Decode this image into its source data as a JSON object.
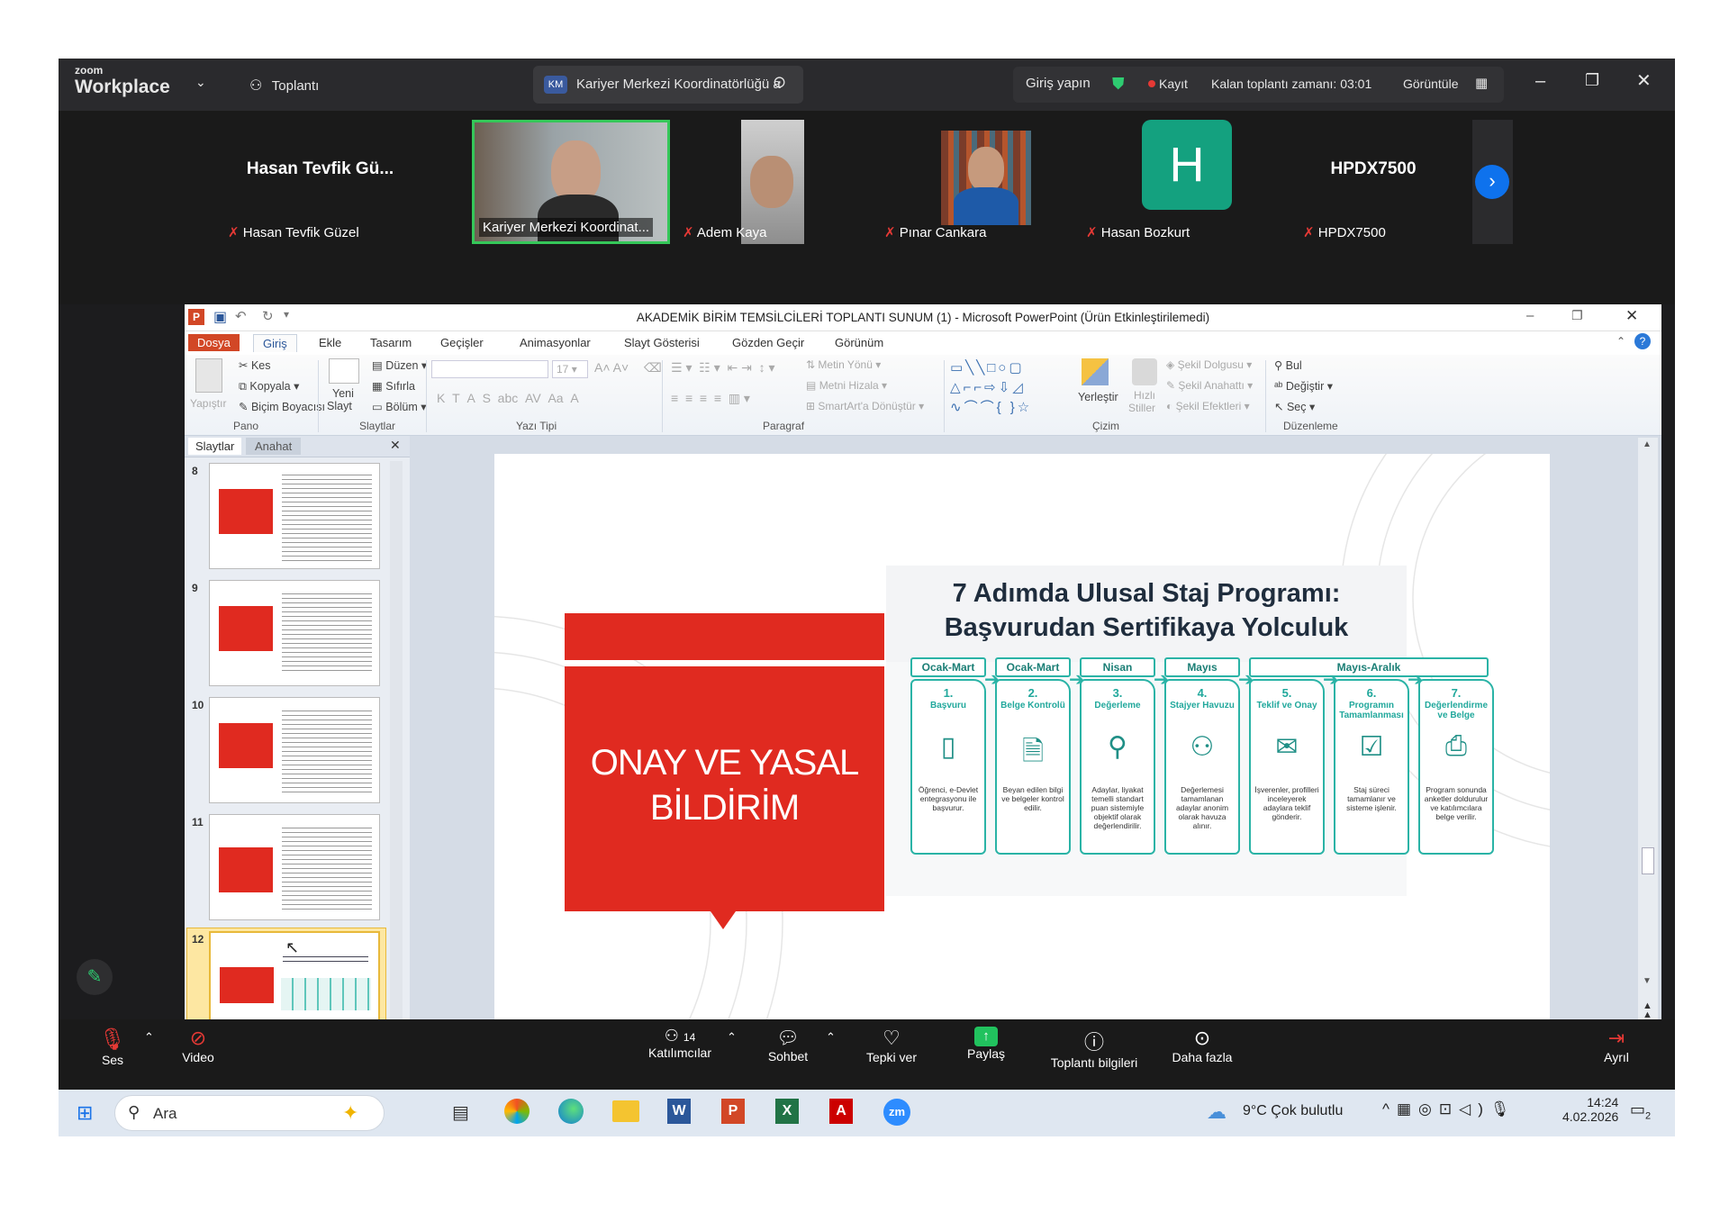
{
  "zoom": {
    "brand_top": "zoom",
    "brand": "Workplace",
    "meeting_btn": "Toplantı",
    "tab_initials": "KM",
    "tab_title": "Kariyer Merkezi Koordinatörlüğü a",
    "signin": "Giriş yapın",
    "record": "Kayıt",
    "remaining": "Kalan toplantı zamanı: 03:01",
    "view": "Görüntüle",
    "participants": [
      {
        "big": "Hasan Tevfik Gü...",
        "name": "Hasan Tevfik Güzel"
      },
      {
        "name": "Kariyer Merkezi Koordinat..."
      },
      {
        "name": "Adem Kaya"
      },
      {
        "name": "Pınar Cankara"
      },
      {
        "initial": "H",
        "name": "Hasan Bozkurt"
      },
      {
        "big": "HPDX7500",
        "name": "HPDX7500"
      }
    ],
    "toolbar": {
      "mute": "Ses",
      "video": "Video",
      "participants": "Katılımcılar",
      "participants_count": "14",
      "chat": "Sohbet",
      "react": "Tepki ver",
      "share": "Paylaş",
      "info": "Toplantı bilgileri",
      "more": "Daha fazla",
      "leave": "Ayrıl"
    }
  },
  "ppt": {
    "window_title": "AKADEMİK BİRİM TEMSİLCİLERİ TOPLANTI SUNUM (1) - Microsoft PowerPoint (Ürün Etkinleştirilemedi)",
    "tabs": [
      "Dosya",
      "Giriş",
      "Ekle",
      "Tasarım",
      "Geçişler",
      "Animasyonlar",
      "Slayt Gösterisi",
      "Gözden Geçir",
      "Görünüm"
    ],
    "ribbon": {
      "paste": "Yapıştır",
      "cut": "Kes",
      "copy": "Kopyala",
      "format_painter": "Biçim Boyacısı",
      "group_clipboard": "Pano",
      "new_slide": "Yeni",
      "new_slide2": "Slayt",
      "layout": "Düzen",
      "reset": "Sıfırla",
      "section": "Bölüm",
      "group_slides": "Slaytlar",
      "font_size": "17",
      "group_font": "Yazı Tipi",
      "text_direction": "Metin Yönü",
      "align_text": "Metni Hizala",
      "smartart": "SmartArt'a Dönüştür",
      "group_paragraph": "Paragraf",
      "arrange": "Yerleştir",
      "quick_styles": "Hızlı",
      "quick_styles2": "Stiller",
      "shape_fill": "Şekil Dolgusu",
      "shape_outline": "Şekil Anahattı",
      "shape_effects": "Şekil Efektleri",
      "group_drawing": "Çizim",
      "find": "Bul",
      "replace": "Değiştir",
      "select": "Seç",
      "group_editing": "Düzenleme"
    },
    "panel_tabs": [
      "Slaytlar",
      "Anahat"
    ],
    "slide_numbers": [
      "8",
      "9",
      "10",
      "11",
      "12"
    ],
    "slide": {
      "left_title_1": "ONAY VE YASAL",
      "left_title_2": "BİLDİRİM",
      "title_1": "7 Adımda Ulusal Staj Programı:",
      "title_2": "Başvurudan Sertifikaya Yolculuk",
      "periods": [
        "Ocak-Mart",
        "Ocak-Mart",
        "Nisan",
        "Mayıs",
        "Mayıs-Aralık"
      ],
      "steps": [
        {
          "n": "1.",
          "t": "Başvuru",
          "d": "Öğrenci, e-Devlet entegrasyonu ile başvurur."
        },
        {
          "n": "2.",
          "t": "Belge Kontrolü",
          "d": "Beyan edilen bilgi ve belgeler kontrol edilir."
        },
        {
          "n": "3.",
          "t": "Değerleme",
          "d": "Adaylar, liyakat temelli standart puan sistemiyle objektif olarak değerlendirilir."
        },
        {
          "n": "4.",
          "t": "Stajyer Havuzu",
          "d": "Değerlemesi tamamlanan adaylar anonim olarak havuza alınır."
        },
        {
          "n": "5.",
          "t": "Teklif ve Onay",
          "d": "İşverenler, profilleri inceleyerek adaylara teklif gönderir."
        },
        {
          "n": "6.",
          "t": "Programın Tamamlanması",
          "d": "Staj süreci tamamlanır ve sisteme işlenir."
        },
        {
          "n": "7.",
          "t": "Değerlendirme ve Belge",
          "d": "Program sonunda anketler doldurulur ve katılımcılara belge verilir."
        }
      ]
    }
  },
  "taskbar": {
    "search": "Ara",
    "weather": "9°C  Çok bulutlu",
    "time": "14:24",
    "date": "4.02.2026",
    "notif": "2"
  }
}
